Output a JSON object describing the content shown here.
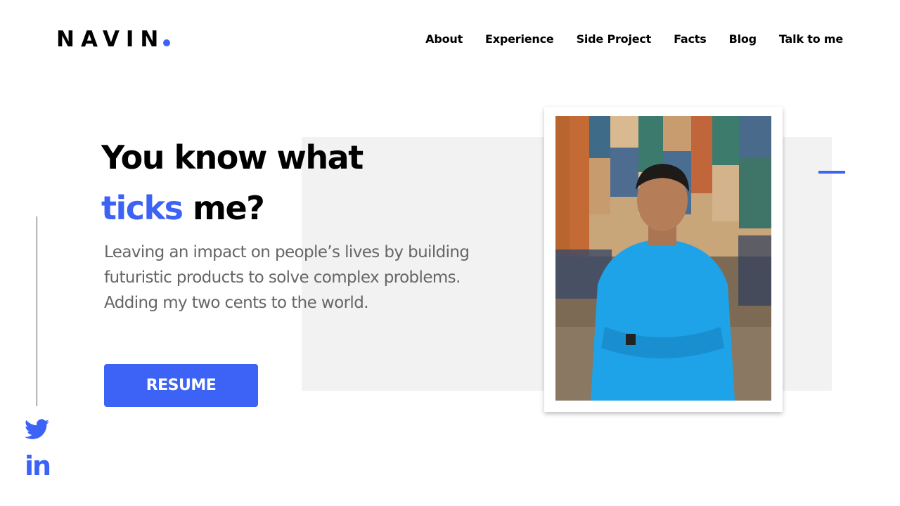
{
  "brand": {
    "name": "NAVIN",
    "accent_color": "#3d63f6"
  },
  "nav": {
    "items": [
      {
        "label": "About"
      },
      {
        "label": "Experience"
      },
      {
        "label": "Side Project"
      },
      {
        "label": "Facts"
      },
      {
        "label": "Blog"
      },
      {
        "label": "Talk to me"
      }
    ]
  },
  "hero": {
    "headline_line1": "You know what",
    "headline_accent": "ticks",
    "headline_rest": " me?",
    "description": "Leaving an impact on people’s lives by building futuristic products to solve complex problems. Adding my two cents to the world.",
    "resume_label": "RESUME",
    "photo_icon": "profile-photo"
  },
  "social": {
    "items": [
      "twitter-icon",
      "linkedin-icon"
    ]
  }
}
